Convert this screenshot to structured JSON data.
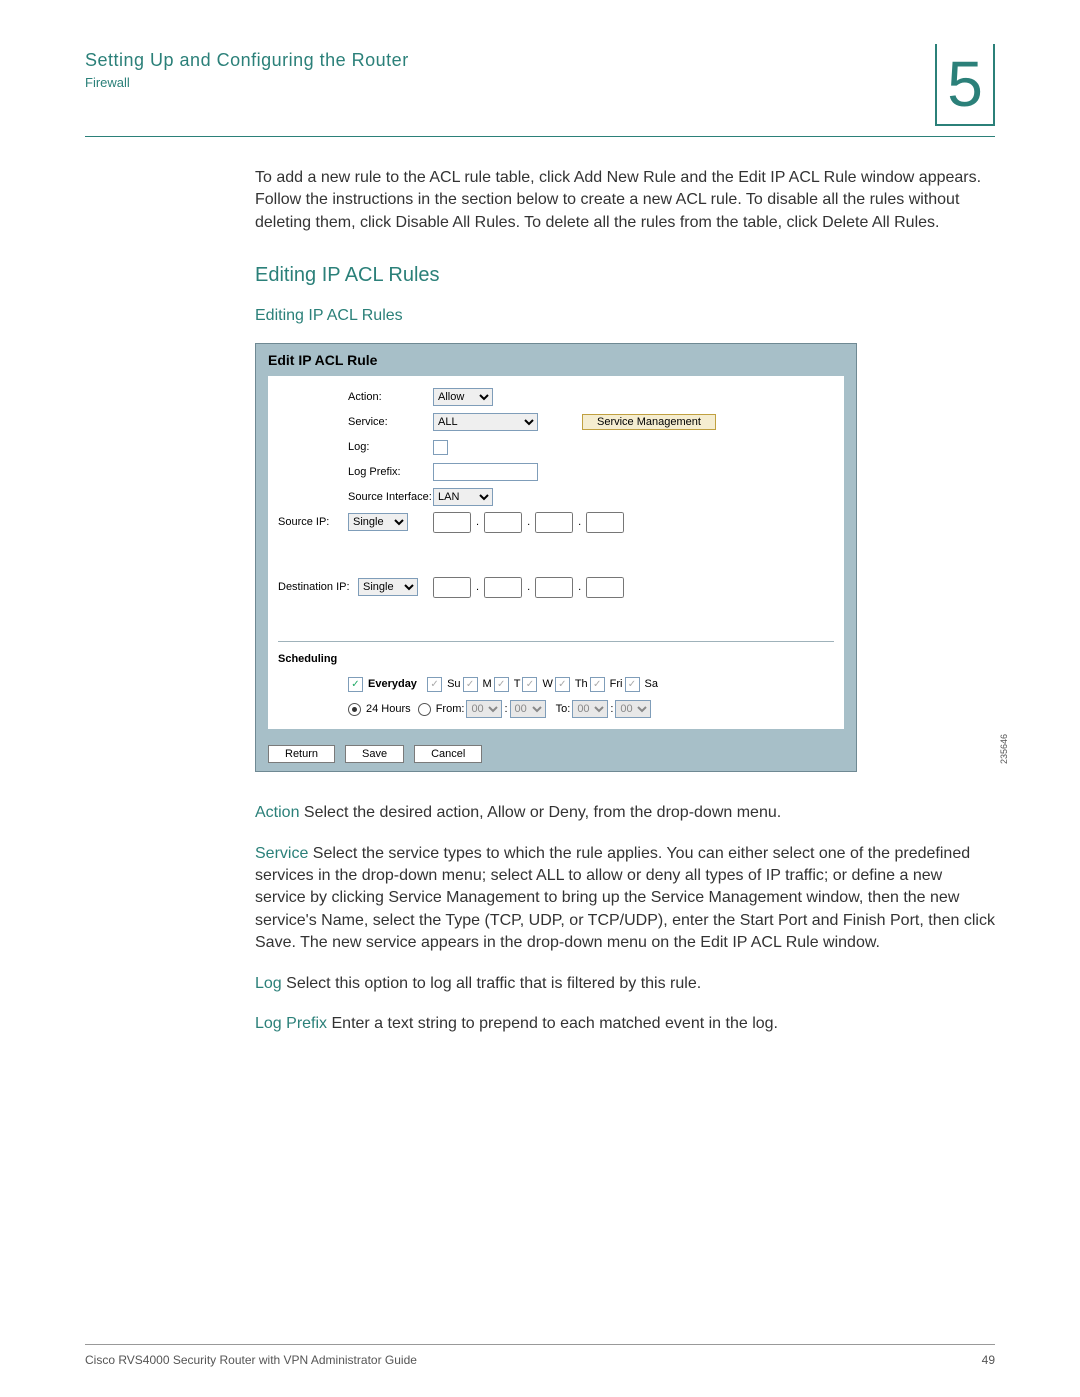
{
  "header": {
    "title": "Setting Up and Configuring the Router",
    "subtitle": "Firewall",
    "chapter": "5"
  },
  "intro_para": "To add a new rule to the ACL rule table, click Add New Rule and the Edit IP ACL Rule window appears. Follow the instructions in the section below to create a new ACL rule. To disable all the rules without deleting them, click Disable All Rules. To delete all the rules from the table, click Delete All Rules.",
  "section_h1": "Editing IP ACL Rules",
  "section_h2": "Editing IP ACL Rules",
  "panel": {
    "title": "Edit IP ACL Rule",
    "labels": {
      "action": "Action:",
      "service": "Service:",
      "log": "Log:",
      "log_prefix": "Log Prefix:",
      "source_if": "Source Interface:",
      "source_ip": "Source IP:",
      "dest_ip": "Destination IP:",
      "scheduling": "Scheduling",
      "from": "From:",
      "to": "To:"
    },
    "values": {
      "action": "Allow",
      "service": "ALL",
      "source_if": "LAN",
      "source_ip_mode": "Single",
      "dest_ip_mode": "Single",
      "everyday_checked": true,
      "days": [
        "Su",
        "M",
        "T",
        "W",
        "Th",
        "Fri",
        "Sa"
      ],
      "hours24_selected": true,
      "time_hh": "00",
      "time_mm": "00"
    },
    "buttons": {
      "svc_mgmt": "Service Management",
      "return": "Return",
      "save": "Save",
      "cancel": "Cancel",
      "everyday": "Everyday",
      "hours24": "24 Hours"
    },
    "figure_id": "235646"
  },
  "defs": {
    "action_term": "Action",
    "action_text": " Select the desired action, Allow or Deny, from the drop-down menu.",
    "service_term": "Service",
    "service_text": " Select the service types to which the rule applies. You can either select one of the predefined services in the drop-down menu; select ALL to allow or deny all types of IP traffic; or define a new service by clicking Service Management to bring up the Service Management window, then the new service's Name, select the Type (TCP, UDP, or TCP/UDP), enter the Start Port and Finish Port, then click Save. The new service appears in the drop-down menu on the Edit IP ACL Rule window.",
    "log_term": "Log",
    "log_text": " Select this option to log all traffic that is filtered by this rule.",
    "logprefix_term": "Log Prefix",
    "logprefix_text": " Enter a text string to prepend to each matched event in the log."
  },
  "footer": {
    "guide": "Cisco RVS4000 Security Router with VPN Administrator Guide",
    "page": "49"
  }
}
